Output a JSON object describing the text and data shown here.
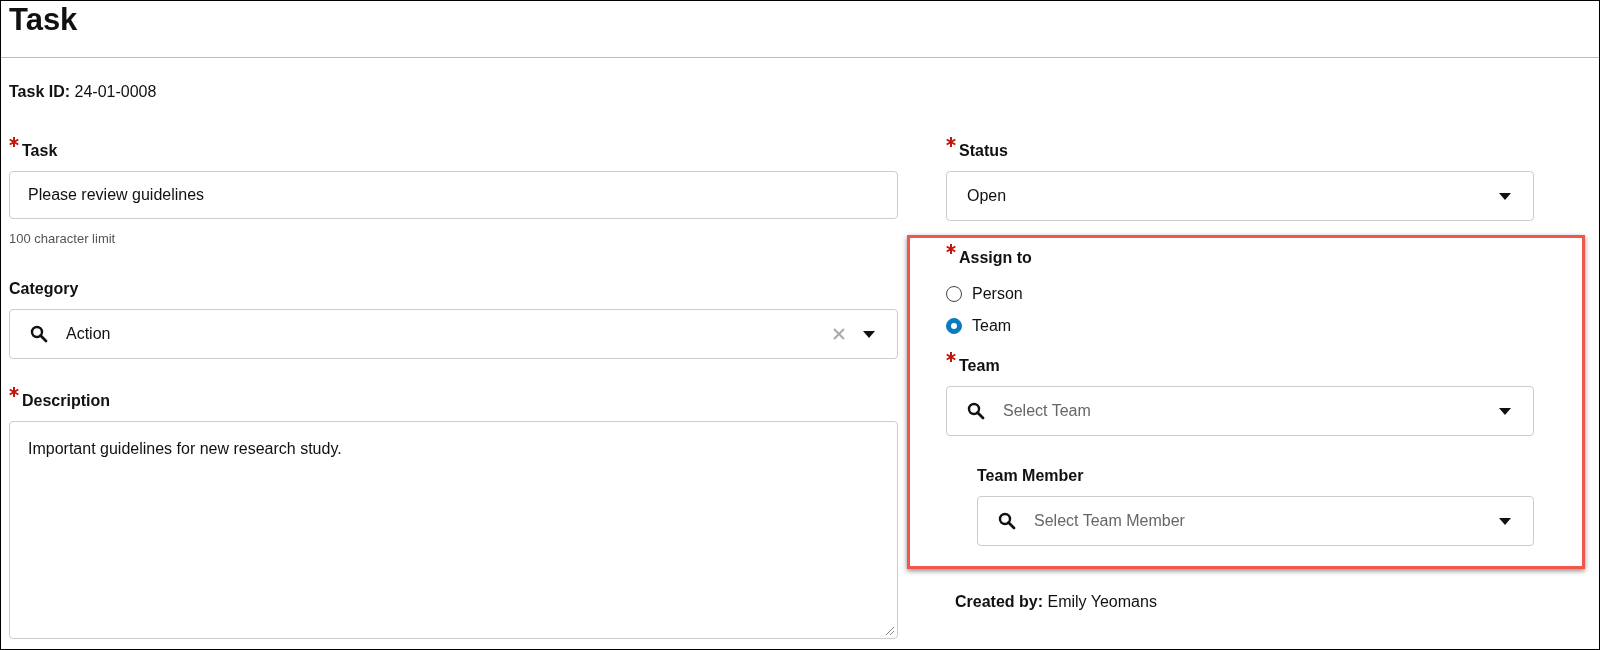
{
  "title": "Task",
  "task_id": {
    "label": "Task ID:",
    "value": "24-01-0008"
  },
  "left": [
    {
      "kind": "text",
      "label": "Task",
      "required": true,
      "value": "Please review guidelines",
      "hint": "100 character limit"
    },
    {
      "kind": "select",
      "label": "Category",
      "required": false,
      "value": "Action",
      "clearable": true
    },
    {
      "kind": "textarea",
      "label": "Description",
      "required": true,
      "value": "Important guidelines for new research study."
    }
  ],
  "status": {
    "label": "Status",
    "required": true,
    "value": "Open"
  },
  "assign": {
    "highlighted": true,
    "label": "Assign to",
    "required": true,
    "options": [
      {
        "label": "Person",
        "selected": false
      },
      {
        "label": "Team",
        "selected": true
      }
    ]
  },
  "team": {
    "label": "Team",
    "required": true,
    "placeholder": "Select Team"
  },
  "team_member": {
    "label": "Team Member",
    "required": false,
    "placeholder": "Select Team Member"
  },
  "created_by": {
    "label": "Created by:",
    "value": "Emily Yeomans"
  }
}
